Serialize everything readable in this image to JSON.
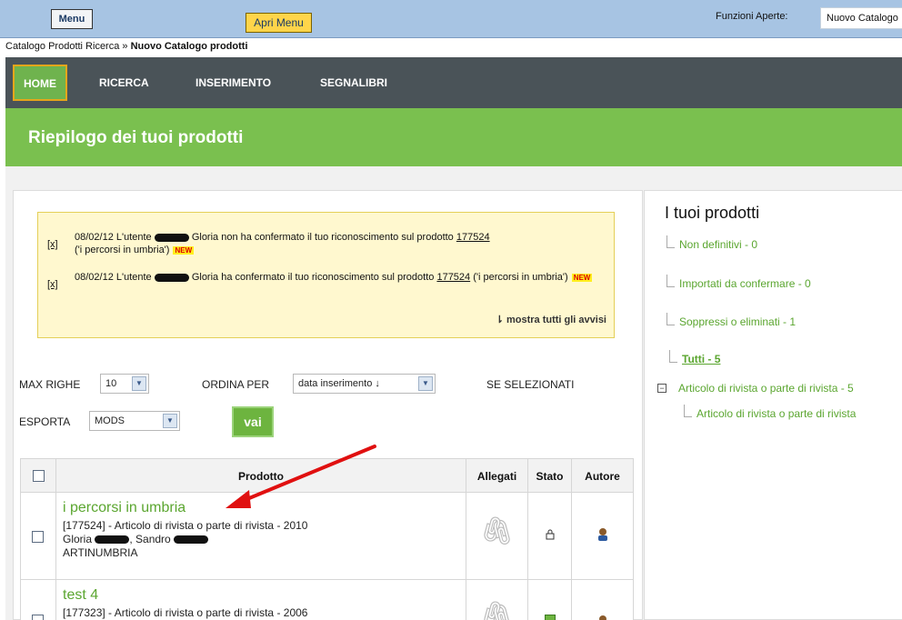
{
  "topbar": {
    "menu_label": "Menu",
    "apri_menu_label": "Apri Menu",
    "funzioni_label": "Funzioni Aperte:",
    "funzioni_value": "Nuovo Catalogo"
  },
  "breadcrumb": {
    "parent": "Catalogo Prodotti Ricerca",
    "separator": " » ",
    "current": "Nuovo Catalogo prodotti"
  },
  "nav": {
    "home": "HOME",
    "ricerca": "RICERCA",
    "inserimento": "INSERIMENTO",
    "segnalibri": "SEGNALIBRI"
  },
  "header": {
    "title": "Riepilogo dei tuoi prodotti"
  },
  "notices": {
    "items": [
      {
        "close": "[x]",
        "date": "08/02/12 L'utente",
        "text_a": "Gloria non ha confermato il tuo riconoscimento sul prodotto",
        "product_id": "177524",
        "text_b": "('i percorsi in umbria')",
        "badge": "NEW"
      },
      {
        "close": "[x]",
        "date": "08/02/12 L'utente",
        "text_a": "Gloria ha confermato il tuo riconoscimento sul prodotto",
        "product_id": "177524",
        "text_b": "('i percorsi in umbria')",
        "badge": "NEW"
      }
    ],
    "show_all": "⇂ mostra tutti gli avvisi"
  },
  "filters": {
    "max_righe_label": "MAX RIGHE",
    "max_righe_value": "10",
    "ordina_label": "ORDINA PER",
    "ordina_value": "data inserimento ↓",
    "se_selezionati": "SE SELEZIONATI",
    "esporta_label": "ESPORTA",
    "esporta_value": "MODS",
    "vai": "vai"
  },
  "table": {
    "headers": {
      "prodotto": "Prodotto",
      "allegati": "Allegati",
      "stato": "Stato",
      "autore": "Autore"
    },
    "rows": [
      {
        "title": "i percorsi in umbria",
        "meta": "[177524] - Articolo di rivista o parte di rivista - 2010",
        "author_a": "Gloria",
        "author_b": ", Sandro",
        "journal": "ARTINUMBRIA"
      },
      {
        "title": "test 4",
        "meta": "[177323] - Articolo di rivista o parte di rivista - 2006"
      }
    ]
  },
  "right": {
    "title": "I tuoi prodotti",
    "items": [
      "Non definitivi - 0",
      "Importati da confermare - 0",
      "Soppressi o eliminati - 1",
      "Tutti - 5"
    ],
    "tree_toggle": "−",
    "tree_parent": "Articolo di rivista o parte di rivista - 5",
    "tree_child": "Articolo di rivista o parte di rivista"
  },
  "colors": {
    "accent_green": "#7ac04f",
    "nav_dark": "#4a5358",
    "topbar_blue": "#a7c4e3",
    "notice_yellow": "#fff8cf",
    "arrow_red": "#e01010"
  }
}
